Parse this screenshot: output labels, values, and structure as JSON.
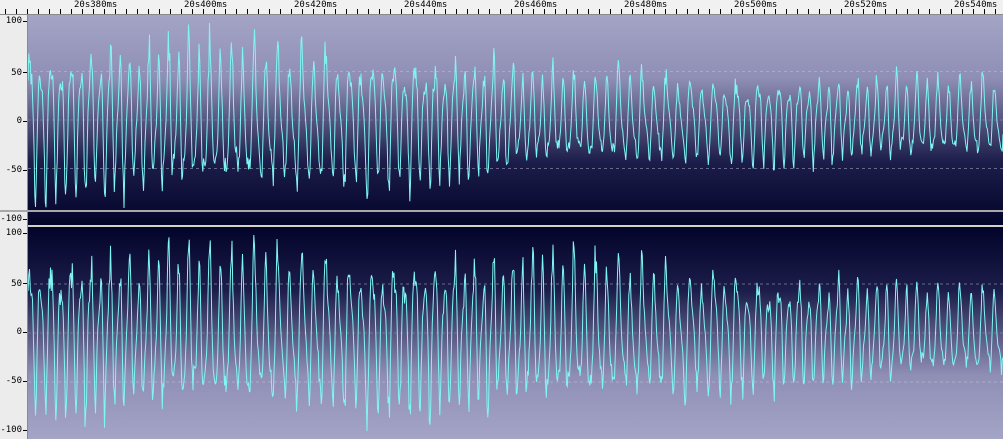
{
  "ruler": {
    "ticks": [
      "20s380ms",
      "20s400ms",
      "20s420ms",
      "20s440ms",
      "20s460ms",
      "20s480ms",
      "20s500ms",
      "20s520ms",
      "20s540ms"
    ]
  },
  "channels": [
    {
      "name": "channel-1",
      "gradient": "top-light",
      "y_labels": [
        "100",
        "50",
        "0",
        "-50",
        "-100"
      ],
      "envelope": [
        [
          0,
          95
        ],
        [
          0.1,
          95
        ],
        [
          0.3,
          90
        ],
        [
          0.5,
          75
        ],
        [
          0.52,
          60
        ],
        [
          1,
          50
        ]
      ],
      "seed": 7
    },
    {
      "name": "channel-2",
      "gradient": "top-dark",
      "y_labels": [
        "100",
        "50",
        "0",
        "-50",
        "-100"
      ],
      "envelope": [
        [
          0,
          100
        ],
        [
          0.45,
          100
        ],
        [
          0.6,
          88
        ],
        [
          0.8,
          70
        ],
        [
          1,
          55
        ]
      ],
      "seed": 13
    }
  ],
  "colors": {
    "wave": "#7ff6f4",
    "bg_light": "#a4a4c6",
    "bg_dark": "#03042a",
    "gridline": "#c8c8dc"
  }
}
